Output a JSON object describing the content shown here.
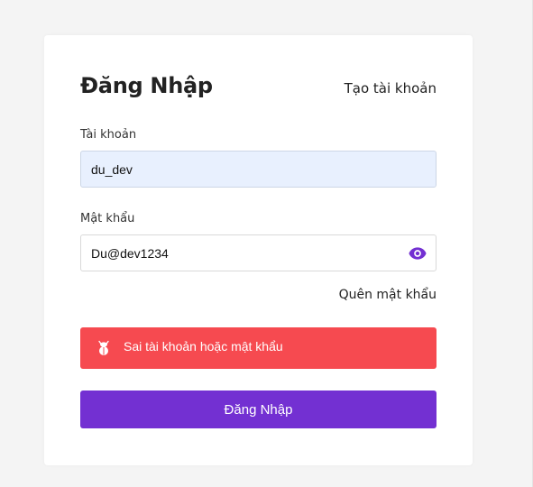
{
  "login": {
    "title": "Đăng Nhập",
    "create_account_link": "Tạo tài khoản",
    "username_label": "Tài khoản",
    "username_value": "du_dev",
    "password_label": "Mật khẩu",
    "password_value": "Du@dev1234",
    "forgot_password_link": "Quên mật khẩu",
    "error_message": "Sai tài khoản hoặc mật khẩu",
    "submit_label": "Đăng Nhập"
  },
  "icons": {
    "password_toggle": "eye-icon",
    "error": "bug-icon"
  },
  "colors": {
    "accent": "#7330d2",
    "error_bg": "#f64a50",
    "autofill_bg": "#e8f0fe",
    "page_bg": "#f4f4f4"
  }
}
